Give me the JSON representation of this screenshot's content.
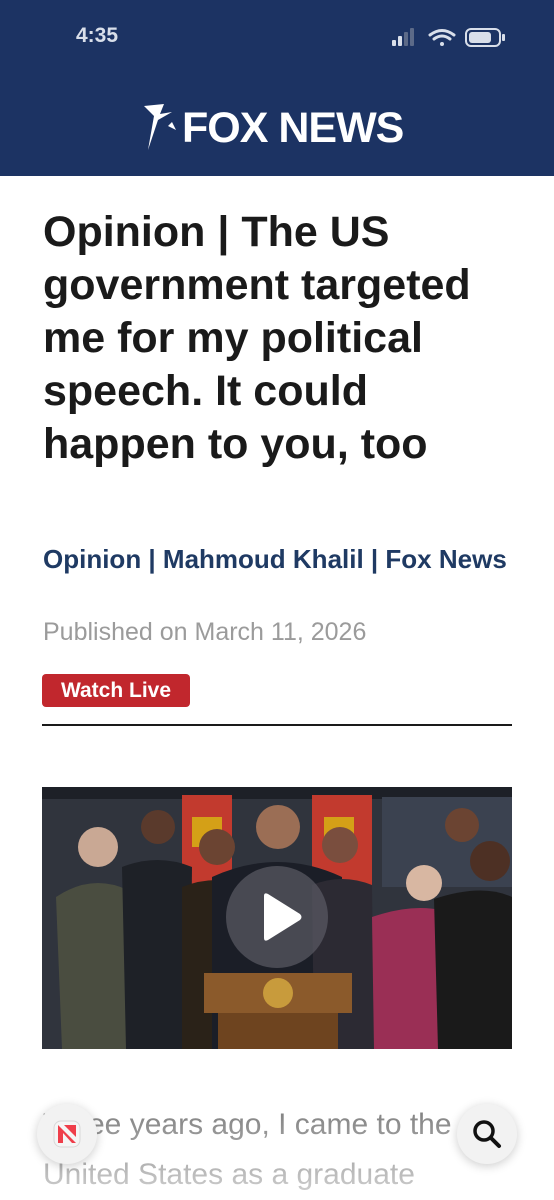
{
  "status_bar": {
    "time": "4:35",
    "icons": [
      "cellular-signal-icon",
      "wifi-icon",
      "battery-icon"
    ]
  },
  "header": {
    "logo_text": "FOX NEWS",
    "background_color": "#1c3363"
  },
  "article": {
    "title": "Opinion | The US government targeted me for my political speech. It could happen to you, too",
    "byline": "Opinion | Mahmoud Khalil | Fox News",
    "published": "Published on March 11, 2026",
    "watch_live_label": "Watch Live",
    "watch_live_color": "#c1272d",
    "video": {
      "description_icon": "play-icon"
    },
    "body_preview": "Three years ago, I came to the United States as a graduate"
  },
  "bottom_controls": {
    "left_icon": "apple-news-icon",
    "right_icon": "search-icon"
  }
}
